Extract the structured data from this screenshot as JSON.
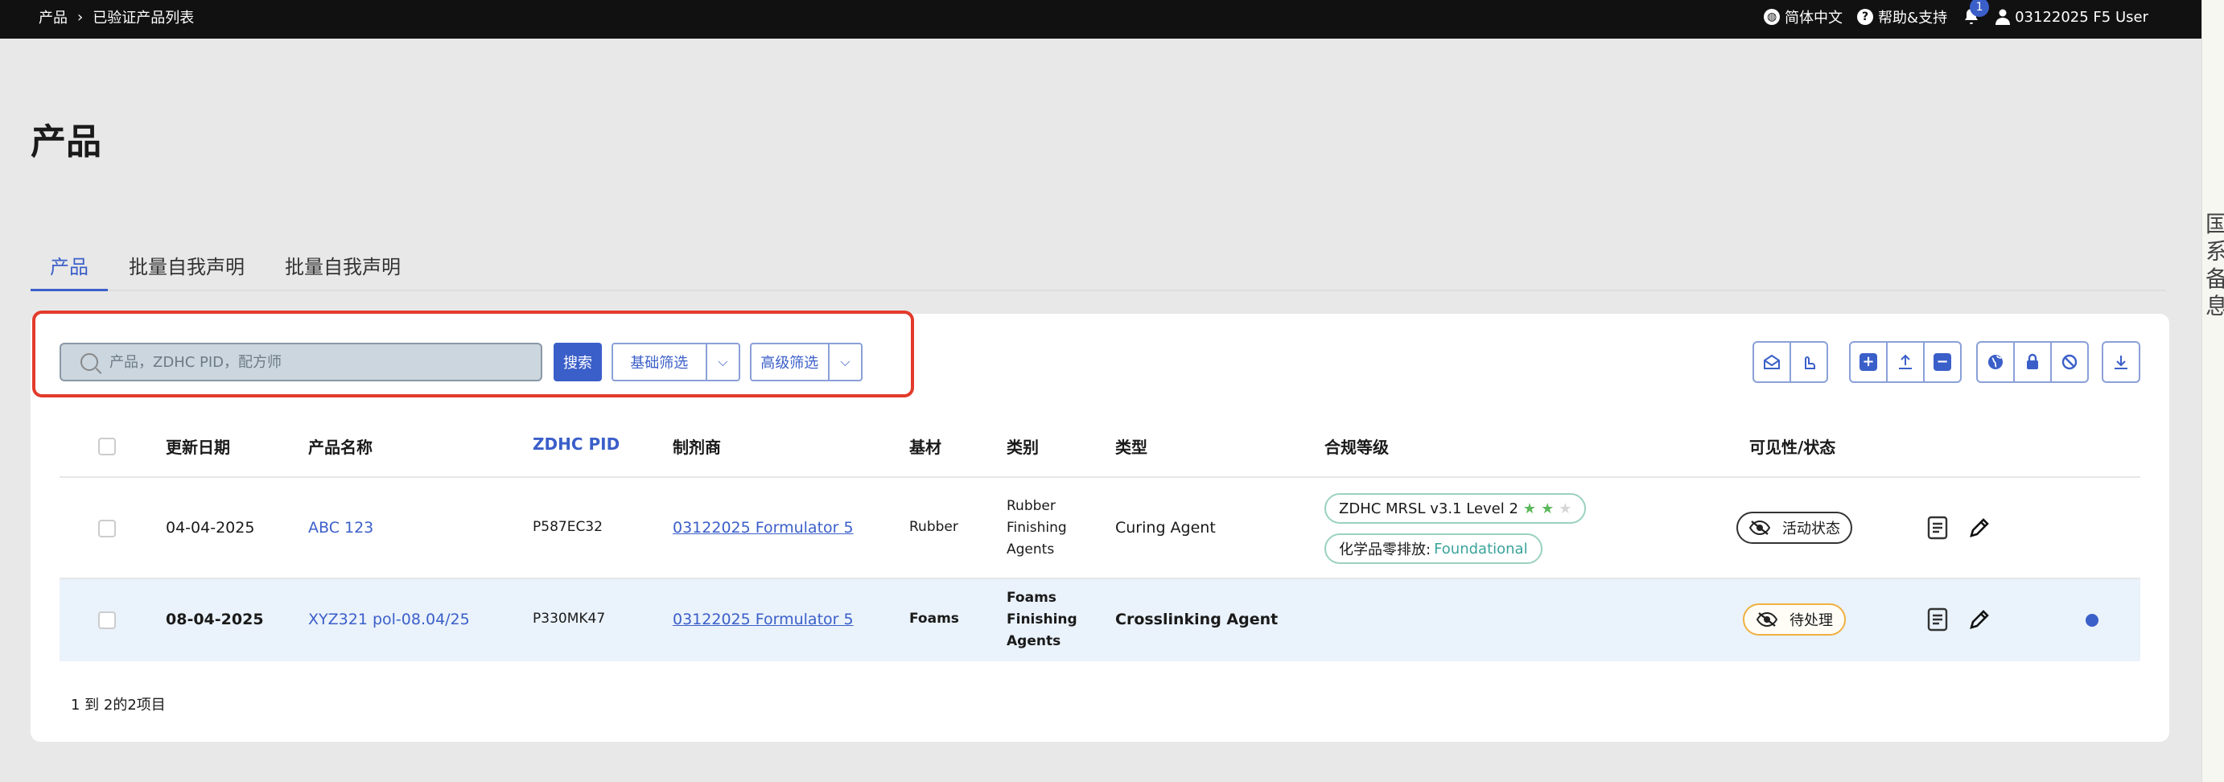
{
  "topbar": {
    "breadcrumb": [
      "产品",
      "已验证产品列表"
    ],
    "language": "简体中文",
    "help": "帮助&支持",
    "notifications": "1",
    "user": "03122025 F5 User"
  },
  "edge_text": "国系备息",
  "page": {
    "title": "产品"
  },
  "tabs": [
    "产品",
    "批量自我声明",
    "批量自我声明"
  ],
  "search": {
    "placeholder": "产品，ZDHC PID，配方师",
    "button": "搜索"
  },
  "filters": {
    "basic": "基础筛选",
    "advanced": "高级筛选"
  },
  "toolbar_icons": [
    "envelope-open-icon",
    "hand-icon",
    "plus-square-icon",
    "upload-icon",
    "minus-square-icon",
    "globe-icon",
    "lock-icon",
    "ban-icon",
    "download-icon"
  ],
  "table": {
    "headers": {
      "date": "更新日期",
      "name": "产品名称",
      "pid": "ZDHC PID",
      "maker": "制剂商",
      "substrate": "基材",
      "category": "类别",
      "type": "类型",
      "compliance": "合规等级",
      "visibility": "可见性/状态"
    },
    "rows": [
      {
        "date": "04-04-2025",
        "name": "ABC 123",
        "pid": "P587EC32",
        "maker": "03122025 Formulator 5",
        "substrate": "Rubber",
        "category": [
          "Rubber",
          "Finishing",
          "Agents"
        ],
        "type": "Curing Agent",
        "mrsl": "ZDHC MRSL v3.1 Level 2",
        "mrsl_stars": "2 of 3",
        "zero_label": "化学品零排放:",
        "zero_value": "Foundational",
        "status": "活动状态"
      },
      {
        "date": "08-04-2025",
        "name": "XYZ321 pol-08.04/25",
        "pid": "P330MK47",
        "maker": "03122025 Formulator 5",
        "substrate": "Foams",
        "category": [
          "Foams",
          "Finishing",
          "Agents"
        ],
        "type": "Crosslinking Agent",
        "status": "待处理"
      }
    ]
  },
  "pager": "1 到 2的2项目",
  "colors": {
    "accent": "#3b5fc9",
    "highlight": "#e23b2b",
    "teal": "#3aa39b",
    "pending": "#f0b040"
  }
}
